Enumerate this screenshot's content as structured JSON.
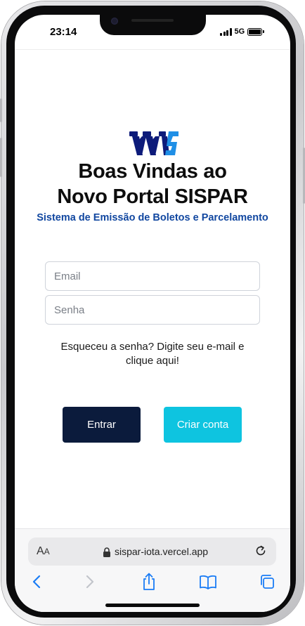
{
  "status_bar": {
    "time": "23:14",
    "network": "5G"
  },
  "header": {
    "title_line1": "Boas Vindas ao",
    "title_line2": "Novo Portal SISPAR",
    "subtitle": "Sistema de Emissão de Boletos e Parcelamento"
  },
  "form": {
    "email_placeholder": "Email",
    "email_value": "",
    "password_placeholder": "Senha",
    "password_value": "",
    "forgot_text": "Esqueceu a senha? Digite seu e-mail e clique aqui!"
  },
  "buttons": {
    "login_label": "Entrar",
    "signup_label": "Criar conta"
  },
  "browser": {
    "reader_label_big": "A",
    "reader_label_small": "A",
    "url": "sispar-iota.vercel.app"
  },
  "colors": {
    "brand_navy": "#0b1b3c",
    "brand_cyan": "#0ec4e0",
    "subtitle_blue": "#1147a0",
    "logo_navy": "#0d1b7a",
    "logo_blue": "#1f8fe6",
    "ios_blue": "#1a7cf5"
  },
  "icons": [
    "logo-icon",
    "signal-icon",
    "battery-icon",
    "lock-icon",
    "reload-icon",
    "back-icon",
    "forward-icon",
    "share-icon",
    "bookmarks-icon",
    "tabs-icon"
  ]
}
